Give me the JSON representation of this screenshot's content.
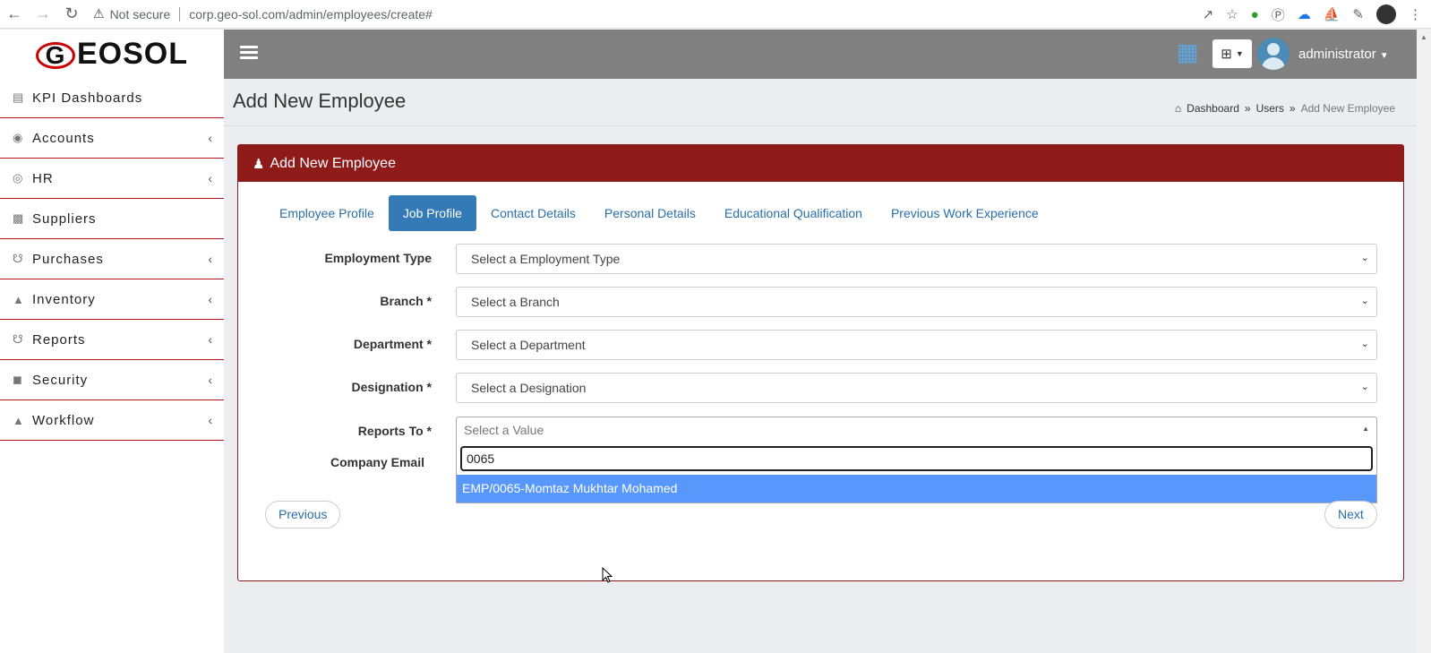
{
  "browser": {
    "security_label": "Not secure",
    "url": "corp.geo-sol.com/admin/employees/create#"
  },
  "sidebar": {
    "logo_text_1": "G",
    "logo_text_2": "EOSOL",
    "items": [
      {
        "label": "KPI Dashboards",
        "icon": "dashboard-icon",
        "has_chevron": false
      },
      {
        "label": "Accounts",
        "icon": "piggy-bank-icon",
        "has_chevron": true
      },
      {
        "label": "HR",
        "icon": "award-icon",
        "has_chevron": true
      },
      {
        "label": "Suppliers",
        "icon": "truck-icon",
        "has_chevron": false
      },
      {
        "label": "Purchases",
        "icon": "cart-icon",
        "has_chevron": true
      },
      {
        "label": "Inventory",
        "icon": "sitemap-icon",
        "has_chevron": true
      },
      {
        "label": "Reports",
        "icon": "cart-icon",
        "has_chevron": true
      },
      {
        "label": "Security",
        "icon": "lock-icon",
        "has_chevron": true
      },
      {
        "label": "Workflow",
        "icon": "sitemap-icon",
        "has_chevron": true
      }
    ]
  },
  "header": {
    "username": "administrator"
  },
  "page": {
    "title": "Add New Employee",
    "breadcrumb": [
      "Dashboard",
      "Users",
      "Add New Employee"
    ]
  },
  "panel": {
    "title": "Add New Employee",
    "tabs": [
      {
        "label": "Employee Profile",
        "active": false
      },
      {
        "label": "Job Profile",
        "active": true
      },
      {
        "label": "Contact Details",
        "active": false
      },
      {
        "label": "Personal Details",
        "active": false
      },
      {
        "label": "Educational Qualification",
        "active": false
      },
      {
        "label": "Previous Work Experience",
        "active": false
      }
    ],
    "fields": {
      "employment_type": {
        "label": "Employment Type",
        "value": "Select a Employment Type"
      },
      "branch": {
        "label": "Branch *",
        "value": "Select a Branch"
      },
      "department": {
        "label": "Department *",
        "value": "Select a Department"
      },
      "designation": {
        "label": "Designation *",
        "value": "Select a Designation"
      },
      "reports_to": {
        "label": "Reports To *",
        "placeholder": "Select a Value",
        "search_value": "0065",
        "option": "EMP/0065-Momtaz Mukhtar Mohamed"
      },
      "company_email": {
        "label": "Company Email"
      }
    },
    "buttons": {
      "previous": "Previous",
      "next": "Next"
    }
  },
  "colors": {
    "brand_red": "#8f1a1a",
    "tab_active": "#337ab7",
    "option_highlight": "#5897fb",
    "topbar": "#808080"
  }
}
